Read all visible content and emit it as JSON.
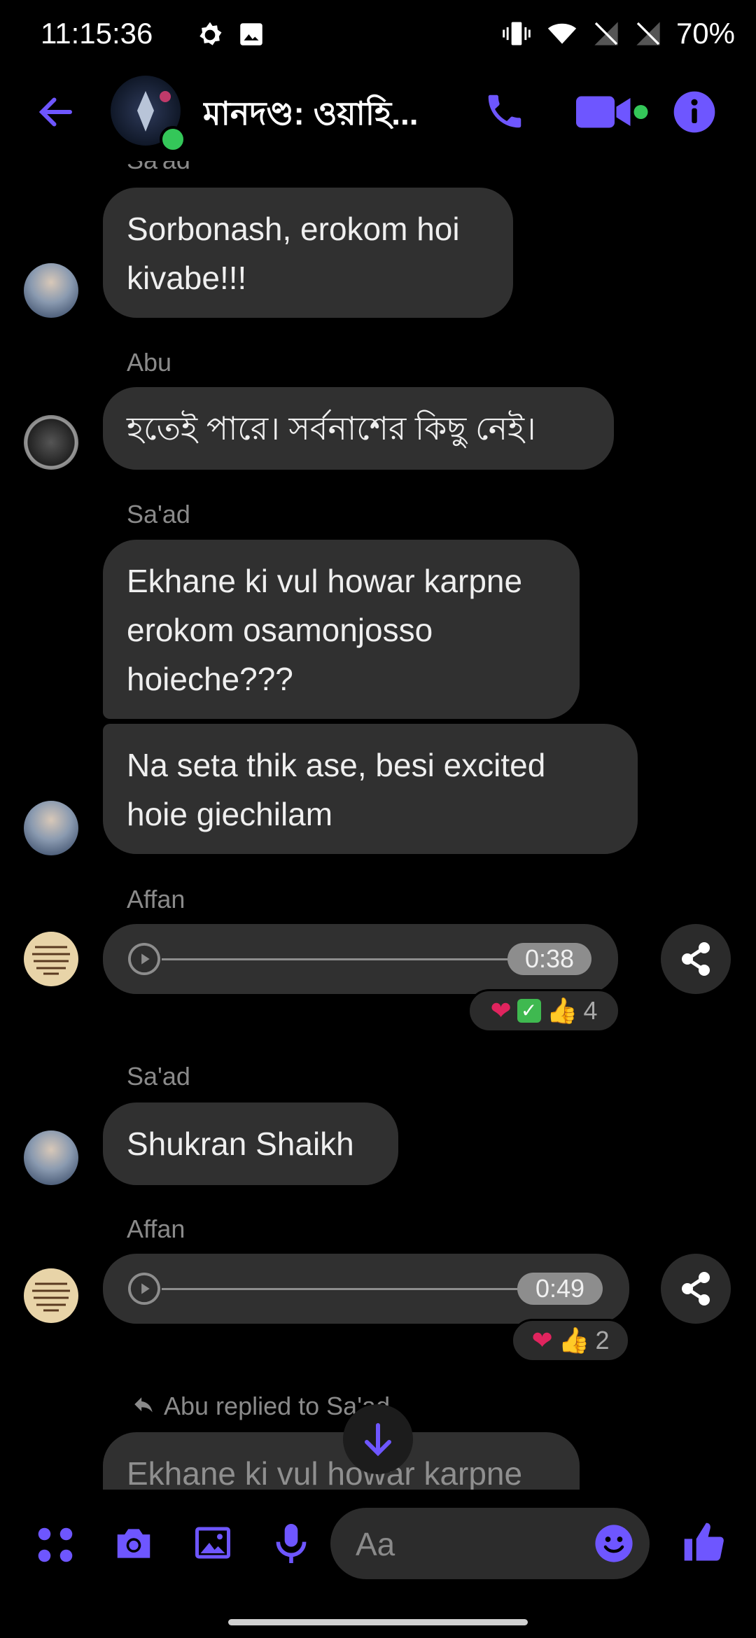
{
  "status_bar": {
    "time": "11:15:36",
    "battery": "70%"
  },
  "header": {
    "title": "মানদণ্ড: ওয়াহি...",
    "accent_color": "#6e56ff",
    "online_color": "#34c759"
  },
  "messages": {
    "m1_sender_partial": "Sa'ad",
    "m1_text": "Sorbonash, erokom hoi kivabe!!!",
    "m2_sender": "Abu",
    "m2_text": "হতেই পারে। সর্বনাশের কিছু নেই।",
    "m3_sender": "Sa'ad",
    "m3_text": "Ekhane ki vul howar karpne erokom osamonjosso hoieche???",
    "m4_text": "Na seta thik ase, besi excited hoie giechilam",
    "m5_sender": "Affan",
    "m5_duration": "0:38",
    "m5_reaction_count": "4",
    "m6_sender": "Sa'ad",
    "m6_text": "Shukran Shaikh",
    "m7_sender": "Affan",
    "m7_duration": "0:49",
    "m7_reaction_count": "2",
    "reply_label": "Abu replied to Sa'ad",
    "m8_text": "Ekhane ki vul howar karpne"
  },
  "composer": {
    "placeholder": "Aa"
  },
  "icons": [
    "back-arrow-icon",
    "phone-icon",
    "video-camera-icon",
    "info-icon",
    "scroll-down-icon",
    "apps-icon",
    "camera-icon",
    "gallery-icon",
    "microphone-icon",
    "emoji-icon",
    "thumbs-up-icon",
    "share-icon",
    "play-icon",
    "reply-icon"
  ]
}
